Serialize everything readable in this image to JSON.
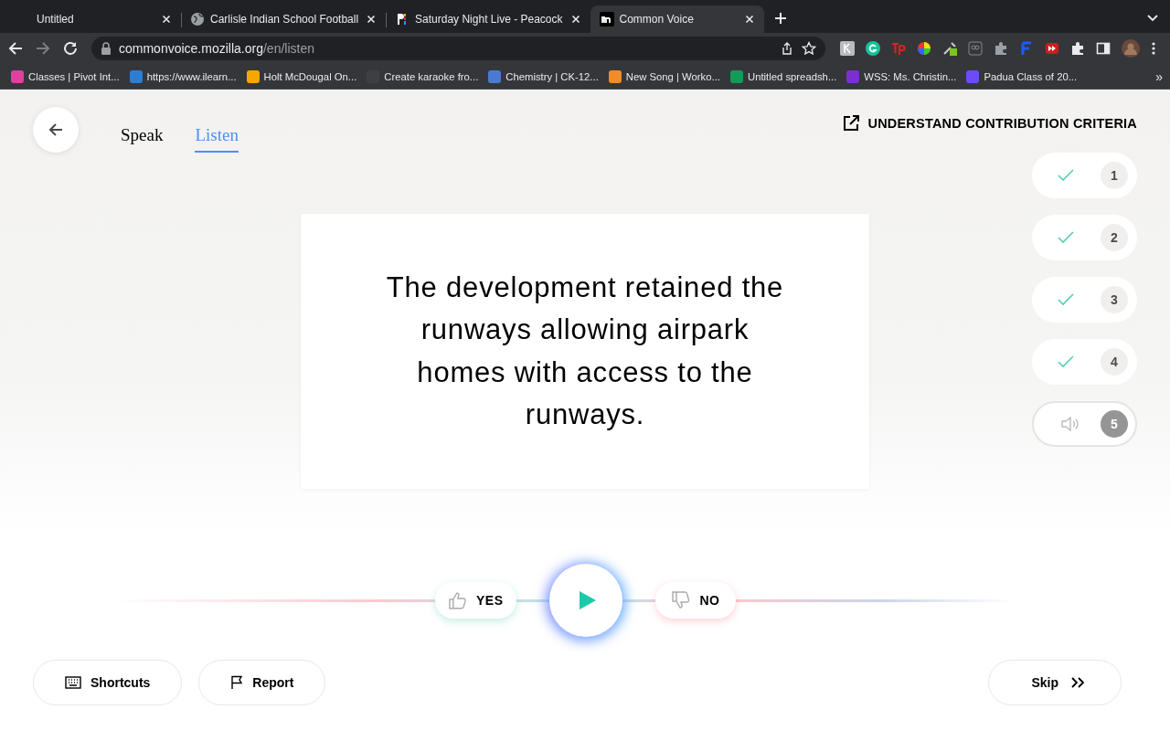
{
  "browser": {
    "tabs": [
      {
        "title": "Untitled",
        "kind": "none",
        "selected": false
      },
      {
        "title": "Carlisle Indian School Football",
        "kind": "globe",
        "selected": false
      },
      {
        "title": "Saturday Night Live - Peacock",
        "kind": "peacock",
        "selected": false
      },
      {
        "title": "Common Voice",
        "kind": "mono",
        "selected": true
      }
    ],
    "address": {
      "host": "commonvoice.mozilla.org",
      "path": "/en/listen"
    },
    "bookmarks": [
      {
        "label": "Classes | Pivot Int...",
        "color": "#e040a0"
      },
      {
        "label": "https://www.ilearn...",
        "color": "#2a7fd4"
      },
      {
        "label": "Holt McDougal On...",
        "color": "#f5a800"
      },
      {
        "label": "Create karaoke fro...",
        "color": "#3c4043"
      },
      {
        "label": "Chemistry | CK-12...",
        "color": "#4a7bd0"
      },
      {
        "label": "New Song | Worko...",
        "color": "#f28c28"
      },
      {
        "label": "Untitled spreadsh...",
        "color": "#0f9d58"
      },
      {
        "label": "WSS: Ms. Christin...",
        "color": "#7b2fd0"
      },
      {
        "label": "Padua Class of 20...",
        "color": "#6b4cf6"
      }
    ],
    "more_bookmarks": "»"
  },
  "page": {
    "nav": [
      {
        "label": "Speak",
        "selected": false
      },
      {
        "label": "Listen",
        "selected": true
      }
    ],
    "criteria_link": "UNDERSTAND CONTRIBUTION CRITERIA",
    "sentence": "The development retained the runways allowing airpark homes with access to the runways.",
    "clips": [
      {
        "number": "1",
        "kind": "done"
      },
      {
        "number": "2",
        "kind": "done"
      },
      {
        "number": "3",
        "kind": "done"
      },
      {
        "number": "4",
        "kind": "done"
      },
      {
        "number": "5",
        "kind": "current"
      }
    ],
    "vote": {
      "yes": "YES",
      "no": "NO"
    },
    "footer": {
      "shortcuts": "Shortcuts",
      "report": "Report",
      "skip": "Skip"
    }
  }
}
